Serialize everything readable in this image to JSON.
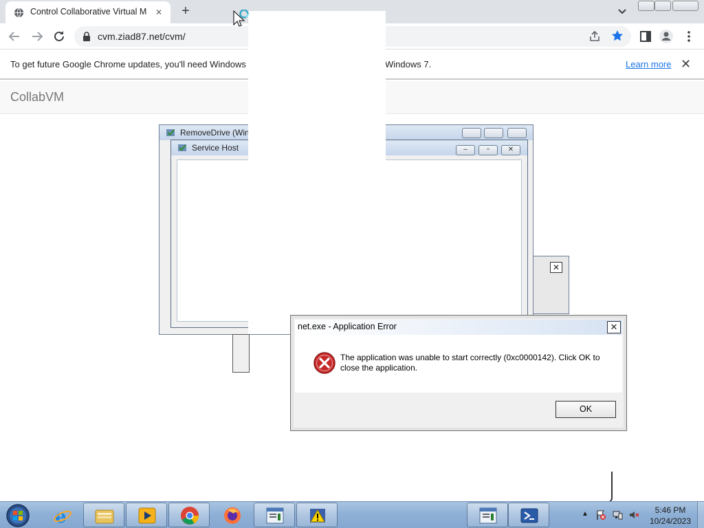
{
  "browser": {
    "tab": {
      "title": "Control Collaborative Virtual Ma",
      "close_glyph": "✕",
      "favicon": "globe-icon"
    },
    "new_tab_glyph": "+",
    "address": {
      "url": "cvm.ziad87.net/cvm/"
    },
    "infobar": {
      "message": "To get future Google Chrome updates, you'll need Windows",
      "message_tail": "Windows 7.",
      "learn_more": "Learn more",
      "close_glyph": "✕"
    },
    "accent_color": "#1a73e8"
  },
  "collabvm": {
    "brand": "CollabVM"
  },
  "vm": {
    "windows": [
      {
        "title": "RemoveDrive (Win"
      },
      {
        "title": "Service Host"
      }
    ],
    "error_dialog": {
      "title": "net.exe - Application Error",
      "message": "The application was unable to start correctly (0xc0000142). Click OK to close the application.",
      "ok_label": "OK",
      "close_glyph": "✕"
    },
    "taskbar": {
      "items": [
        "start-orb",
        "internet-explorer",
        "file-explorer",
        "media-player",
        "chrome",
        "firefox",
        "app-window",
        "security-warning-app",
        "app-window-2",
        "powershell"
      ],
      "clock": {
        "time": "5:46 PM",
        "date": "10/24/2023"
      },
      "tray_chevron": "▲"
    }
  }
}
